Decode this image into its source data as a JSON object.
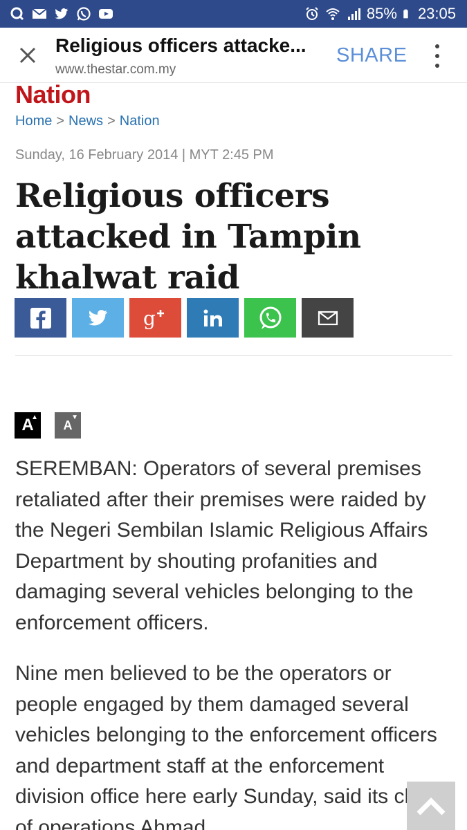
{
  "status_bar": {
    "battery": "85%",
    "time": "23:05"
  },
  "browser": {
    "page_title": "Religious officers attacke...",
    "url": "www.thestar.com.my",
    "share_label": "SHARE"
  },
  "article": {
    "section": "Nation",
    "breadcrumb": [
      "Home",
      "News",
      "Nation"
    ],
    "breadcrumb_separator": ">",
    "dateline": "Sunday, 16 February 2014 | MYT 2:45 PM",
    "headline": "Religious officers attacked in Tampin khalwat raid",
    "font_increase_label": "A",
    "font_decrease_label": "A",
    "paragraphs": [
      "SEREMBAN: Operators of several premises retaliated after their premises were raided by the Negeri Sembilan Islamic Religious Affairs Department by shouting profanities and damaging several vehicles belonging to the enforcement officers.",
      "Nine men believed to be the operators or people engaged by them damaged several vehicles belonging to the enforcement officers and department staff at the enforcement division office here early Sunday, said its chief of operations Ahmad"
    ]
  },
  "share_buttons": [
    {
      "name": "facebook",
      "color": "#3b5a98"
    },
    {
      "name": "twitter",
      "color": "#5db0e6"
    },
    {
      "name": "google-plus",
      "color": "#dd4b39"
    },
    {
      "name": "linkedin",
      "color": "#2f7bb6"
    },
    {
      "name": "whatsapp",
      "color": "#3cc34d"
    },
    {
      "name": "email",
      "color": "#444444"
    }
  ],
  "colors": {
    "status_bar": "#2f4a8a",
    "section_red": "#c0161b",
    "link_blue": "#2a72b0",
    "share_text": "#5b8fd8"
  }
}
